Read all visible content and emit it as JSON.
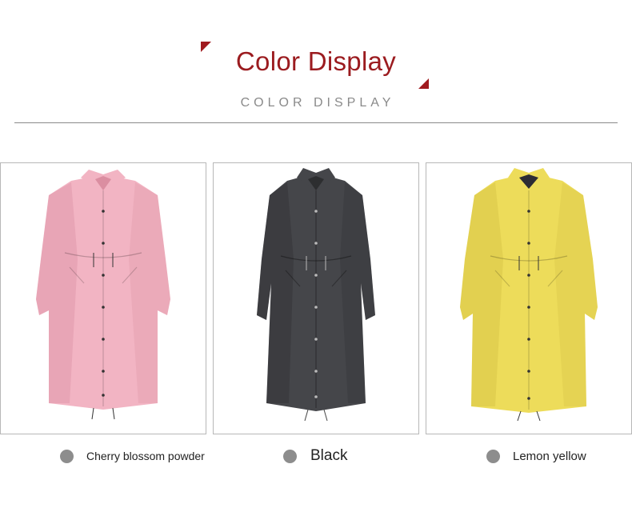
{
  "header": {
    "title": "Color Display",
    "subtitle": "COLOR DISPLAY",
    "accent_color": "#9b1b1f"
  },
  "products": [
    {
      "label": "Cherry blossom powder",
      "coat_color": "#f2b4c3",
      "shade_color": "#d88a9d",
      "dot_color": "#8d8d8d"
    },
    {
      "label": "Black",
      "coat_color": "#45464a",
      "shade_color": "#2a2b2e",
      "dot_color": "#8d8d8d"
    },
    {
      "label": "Lemon yellow",
      "coat_color": "#eddc5a",
      "shade_color": "#c9b53a",
      "dot_color": "#8d8d8d"
    }
  ]
}
